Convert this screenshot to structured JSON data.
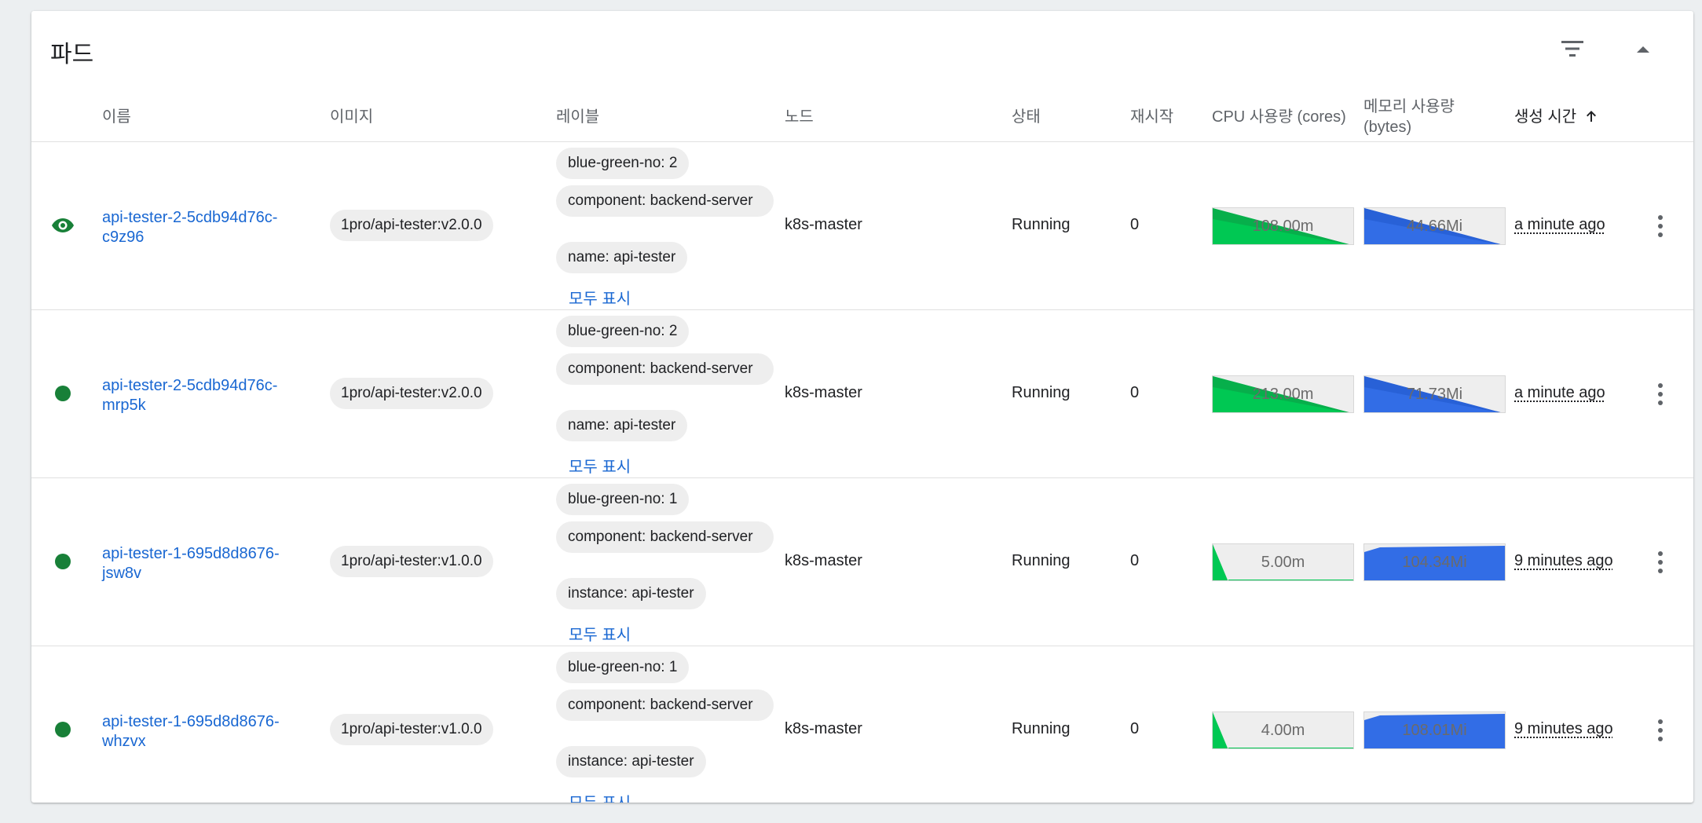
{
  "card": {
    "title": "파드"
  },
  "columns": {
    "name": "이름",
    "image": "이미지",
    "labels": "레이블",
    "node": "노드",
    "status": "상태",
    "restarts": "재시작",
    "cpu": "CPU 사용량 (cores)",
    "memory_line1": "메모리 사용량",
    "memory_line2": "(bytes)",
    "created": "생성 시간"
  },
  "icons": {
    "filter": "filter-icon",
    "collapse": "expand-less-icon",
    "sort": "arrow-upward-icon",
    "viewing": "eye-icon",
    "running": "status-dot-icon",
    "more": "more-vert-icon"
  },
  "colors": {
    "link": "#1967d2",
    "running_green": "#188038",
    "cpu_green": "#00c853",
    "memory_blue": "#326de6"
  },
  "show_all_label": "모두 표시",
  "pods": [
    {
      "name_line1": "api-tester-2-5cdb94d76c-",
      "name_line2": "c9z96",
      "status_icon": "eye-icon",
      "image": "1pro/api-tester:v2.0.0",
      "labels": [
        "blue-green-no: 2",
        "component: backend-server",
        "name: api-tester"
      ],
      "node": "k8s-master",
      "status": "Running",
      "restarts": "0",
      "cpu": "108.00m",
      "memory": "44.66Mi",
      "created": "a minute ago"
    },
    {
      "name_line1": "api-tester-2-5cdb94d76c-",
      "name_line2": "mrp5k",
      "status_icon": "status-dot-icon",
      "image": "1pro/api-tester:v2.0.0",
      "labels": [
        "blue-green-no: 2",
        "component: backend-server",
        "name: api-tester"
      ],
      "node": "k8s-master",
      "status": "Running",
      "restarts": "0",
      "cpu": "213.00m",
      "memory": "71.73Mi",
      "created": "a minute ago"
    },
    {
      "name_line1": "api-tester-1-695d8d8676-",
      "name_line2": "jsw8v",
      "status_icon": "status-dot-icon",
      "image": "1pro/api-tester:v1.0.0",
      "labels": [
        "blue-green-no: 1",
        "component: backend-server",
        "instance: api-tester"
      ],
      "node": "k8s-master",
      "status": "Running",
      "restarts": "0",
      "cpu": "5.00m",
      "memory": "104.34Mi",
      "created": "9 minutes ago"
    },
    {
      "name_line1": "api-tester-1-695d8d8676-",
      "name_line2": "whzvx",
      "status_icon": "status-dot-icon",
      "image": "1pro/api-tester:v1.0.0",
      "labels": [
        "blue-green-no: 1",
        "component: backend-server",
        "instance: api-tester"
      ],
      "node": "k8s-master",
      "status": "Running",
      "restarts": "0",
      "cpu": "4.00m",
      "memory": "108.01Mi",
      "created": "9 minutes ago"
    }
  ]
}
